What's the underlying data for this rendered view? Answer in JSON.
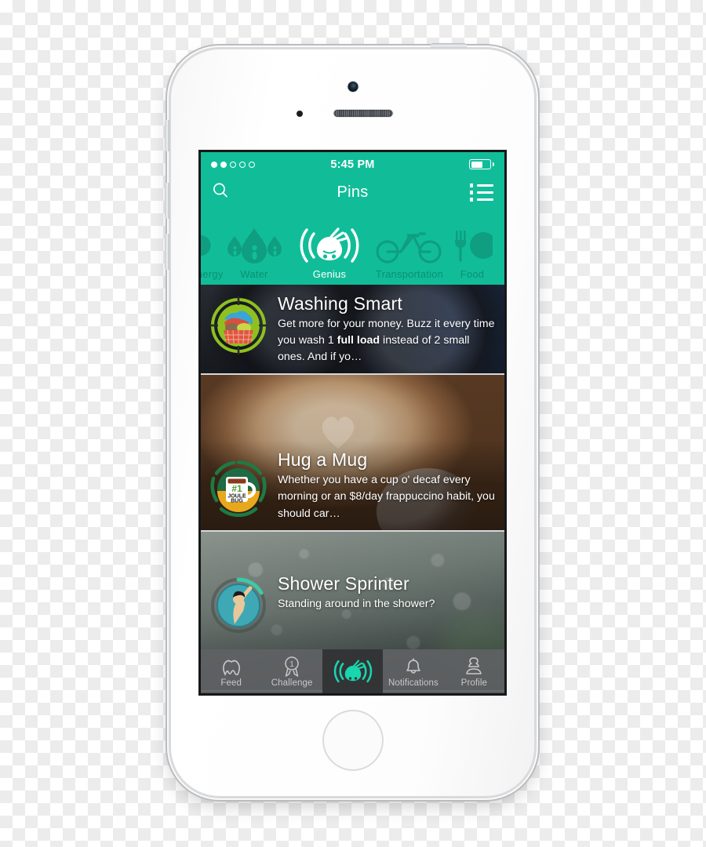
{
  "device": {
    "name": "iphone-5s-silver",
    "home_button": "home-button",
    "camera": "front-camera",
    "speaker": "earpiece-speaker"
  },
  "status_bar": {
    "signal_dots_total": 5,
    "signal_dots_filled": 2,
    "time": "5:45 PM",
    "battery_percent": 62
  },
  "nav_bar": {
    "search_icon": "search-icon",
    "title": "Pins",
    "list_icon": "list-view-icon"
  },
  "categories": {
    "items": [
      {
        "label": "Energy",
        "icon": "energy-icon",
        "active": false,
        "partial": true
      },
      {
        "label": "Water",
        "icon": "water-drop-icon",
        "active": false,
        "partial": false
      },
      {
        "label": "Genius",
        "icon": "genius-bug-icon",
        "active": true,
        "partial": false
      },
      {
        "label": "Transportation",
        "icon": "bicycle-icon",
        "active": false,
        "partial": false
      },
      {
        "label": "Food",
        "icon": "fork-knife-icon",
        "active": false,
        "partial": true
      }
    ]
  },
  "cards": [
    {
      "id": "washing-smart",
      "title": "Washing Smart",
      "desc_pre": "Get more for your money. Buzz it every time you wash 1 ",
      "desc_bold": "full load",
      "desc_post": " instead of 2 small ones. And if yo…",
      "badge": "laundry-basket-badge",
      "background": "laundromat-photo"
    },
    {
      "id": "hug-a-mug",
      "title": "Hug a Mug",
      "desc_pre": "Whether you have a cup o' decaf every morning or an $8/day frappuccino habit, you should car…",
      "desc_bold": "",
      "desc_post": "",
      "badge": "joule-bug-mug-badge",
      "badge_text_top": "#1",
      "badge_text_mid": "JOULE",
      "badge_text_bot": "BUG",
      "background": "latte-photo"
    },
    {
      "id": "shower-sprinter",
      "title": "Shower Sprinter",
      "desc_pre": "Standing around in the shower?",
      "desc_bold": "",
      "desc_post": "",
      "badge": "shower-person-badge",
      "background": "water-droplets-photo"
    }
  ],
  "tab_bar": {
    "items": [
      {
        "label": "Feed",
        "icon": "cloud-feed-icon",
        "active": false,
        "badge": ""
      },
      {
        "label": "Challenge",
        "icon": "ribbon-award-icon",
        "active": false,
        "badge": "1"
      },
      {
        "label": "",
        "icon": "genius-bug-icon",
        "active": true,
        "badge": ""
      },
      {
        "label": "Notifications",
        "icon": "bell-icon",
        "active": false,
        "badge": ""
      },
      {
        "label": "Profile",
        "icon": "person-profile-icon",
        "active": false,
        "badge": ""
      }
    ]
  },
  "colors": {
    "brand_teal": "#11bd99",
    "brand_teal_dark": "#0f9e80",
    "accent_green": "#18d6ad",
    "tab_bar": "#606264",
    "tab_active": "#303234"
  }
}
